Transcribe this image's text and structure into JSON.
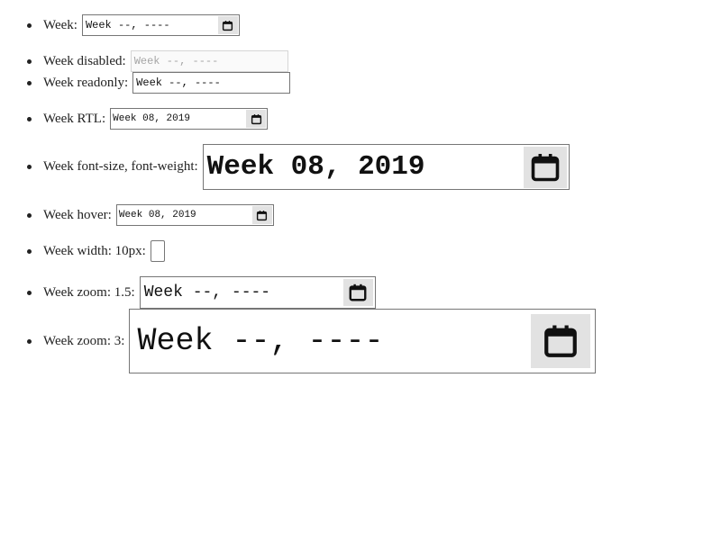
{
  "items": [
    {
      "label": "Week:",
      "value": "Week --, ----"
    },
    {
      "label": "Week disabled:",
      "value": "Week --, ----"
    },
    {
      "label": "Week readonly:",
      "value": "Week --, ----"
    },
    {
      "label": "Week RTL:",
      "value": "Week 08, 2019"
    },
    {
      "label": "Week font-size, font-weight:",
      "value": "Week 08, 2019"
    },
    {
      "label": "Week hover:",
      "value": "Week 08, 2019"
    },
    {
      "label": "Week width: 10px:",
      "value": ""
    },
    {
      "label": "Week zoom: 1.5:",
      "value": "Week --, ----"
    },
    {
      "label": "Week zoom: 3:",
      "value": "Week --, ----"
    }
  ],
  "icons": {
    "picker": "calendar-icon"
  }
}
